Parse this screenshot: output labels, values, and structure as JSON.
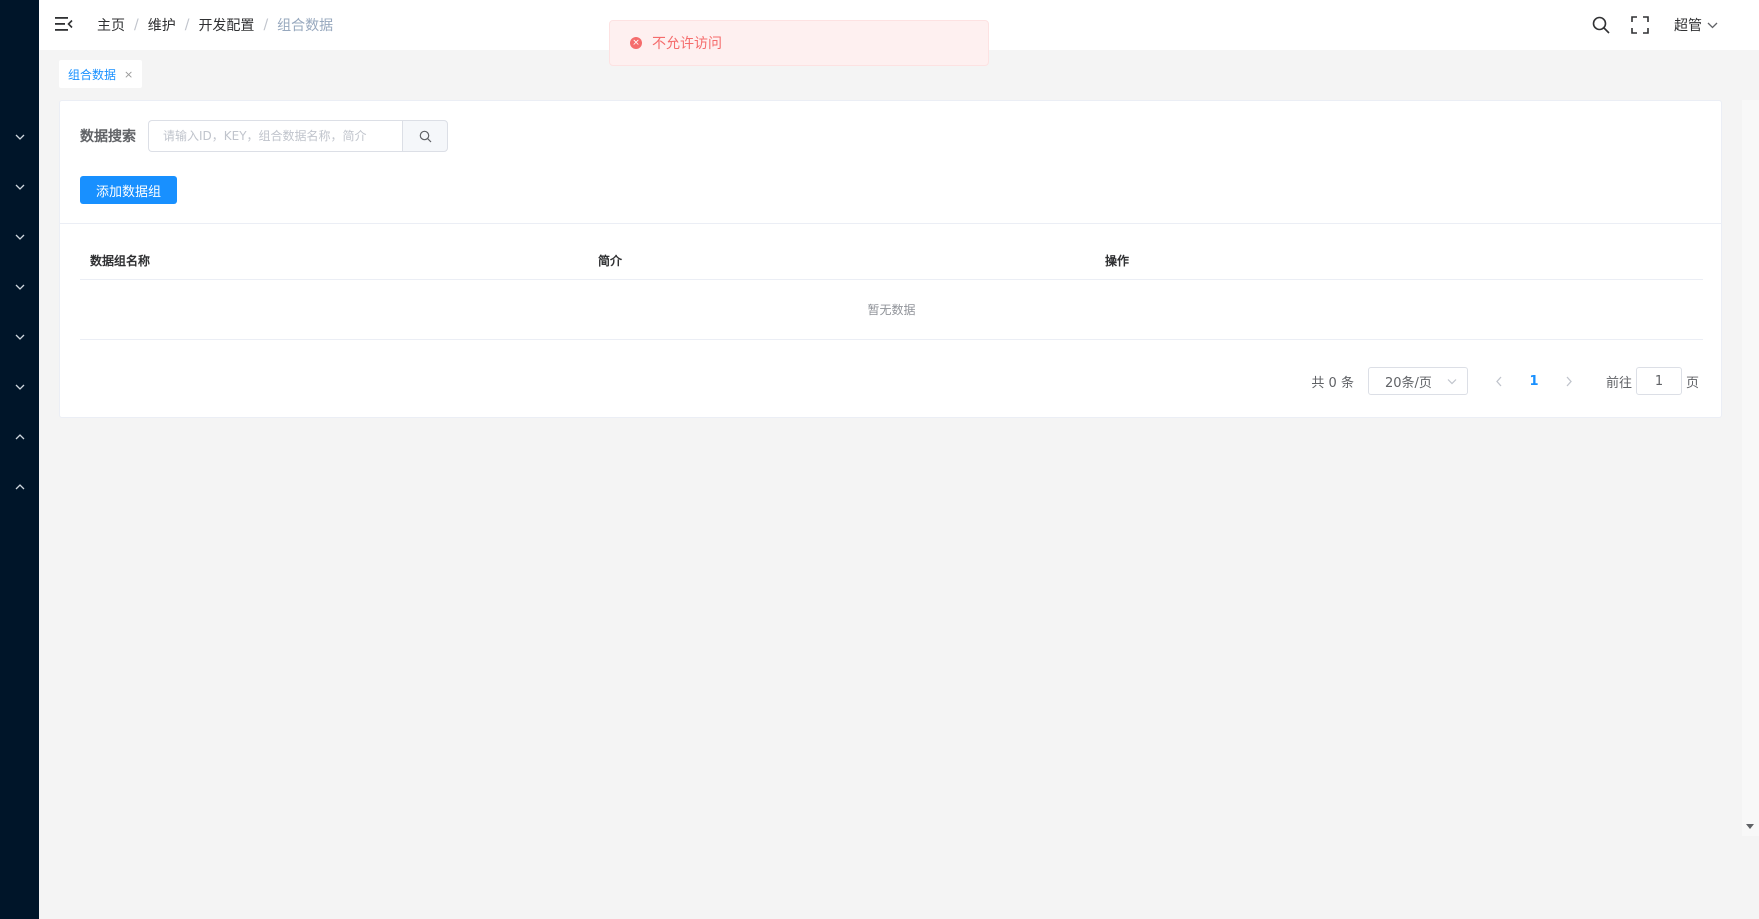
{
  "breadcrumb": {
    "items": [
      "主页",
      "维护",
      "开发配置",
      "组合数据"
    ],
    "separator": "/"
  },
  "header": {
    "user_name": "超管",
    "icons": [
      "menu-fold-icon",
      "search-icon",
      "fullscreen-icon",
      "chevron-down-icon"
    ]
  },
  "toast": {
    "message": "不允许访问",
    "type": "error",
    "icon": "close-circle-icon",
    "icon_glyph": "×"
  },
  "tags": [
    {
      "label": "组合数据",
      "close": "×"
    }
  ],
  "search": {
    "label": "数据搜索",
    "placeholder": "请输入ID，KEY，组合数据名称，简介"
  },
  "actions": {
    "add_label": "添加数据组"
  },
  "table": {
    "columns": [
      "数据组名称",
      "简介",
      "操作"
    ],
    "rows": [],
    "empty_text": "暂无数据"
  },
  "pagination": {
    "total_text": "共 0 条",
    "page_size": "20条/页",
    "current_page": "1",
    "goto_prefix": "前往",
    "goto_value": "1",
    "goto_suffix": "页"
  },
  "sidebar": {
    "items": [
      {
        "icon": "chevron-down-icon"
      },
      {
        "icon": "chevron-down-icon"
      },
      {
        "icon": "chevron-down-icon"
      },
      {
        "icon": "chevron-down-icon"
      },
      {
        "icon": "chevron-down-icon"
      },
      {
        "icon": "chevron-down-icon"
      },
      {
        "icon": "chevron-up-icon"
      },
      {
        "icon": "chevron-up-icon"
      }
    ]
  },
  "colors": {
    "sidebar_bg": "#001529",
    "primary": "#1890ff",
    "error": "#f56c6c",
    "page_bg": "#f4f4f4"
  }
}
